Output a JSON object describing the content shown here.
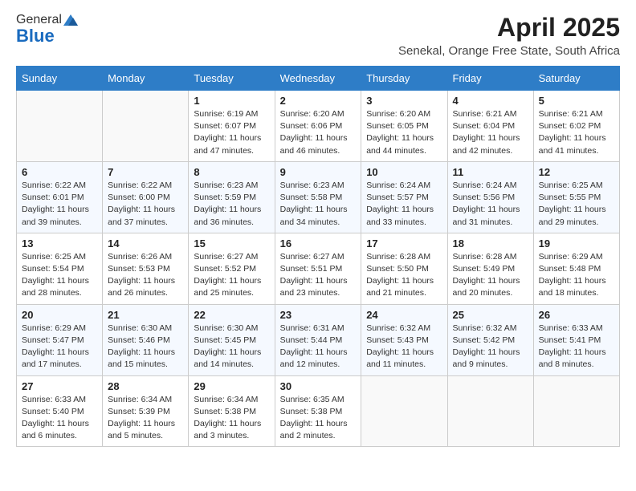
{
  "logo": {
    "general": "General",
    "blue": "Blue"
  },
  "title": "April 2025",
  "location": "Senekal, Orange Free State, South Africa",
  "days_of_week": [
    "Sunday",
    "Monday",
    "Tuesday",
    "Wednesday",
    "Thursday",
    "Friday",
    "Saturday"
  ],
  "weeks": [
    [
      {
        "day": "",
        "info": ""
      },
      {
        "day": "",
        "info": ""
      },
      {
        "day": "1",
        "info": "Sunrise: 6:19 AM\nSunset: 6:07 PM\nDaylight: 11 hours and 47 minutes."
      },
      {
        "day": "2",
        "info": "Sunrise: 6:20 AM\nSunset: 6:06 PM\nDaylight: 11 hours and 46 minutes."
      },
      {
        "day": "3",
        "info": "Sunrise: 6:20 AM\nSunset: 6:05 PM\nDaylight: 11 hours and 44 minutes."
      },
      {
        "day": "4",
        "info": "Sunrise: 6:21 AM\nSunset: 6:04 PM\nDaylight: 11 hours and 42 minutes."
      },
      {
        "day": "5",
        "info": "Sunrise: 6:21 AM\nSunset: 6:02 PM\nDaylight: 11 hours and 41 minutes."
      }
    ],
    [
      {
        "day": "6",
        "info": "Sunrise: 6:22 AM\nSunset: 6:01 PM\nDaylight: 11 hours and 39 minutes."
      },
      {
        "day": "7",
        "info": "Sunrise: 6:22 AM\nSunset: 6:00 PM\nDaylight: 11 hours and 37 minutes."
      },
      {
        "day": "8",
        "info": "Sunrise: 6:23 AM\nSunset: 5:59 PM\nDaylight: 11 hours and 36 minutes."
      },
      {
        "day": "9",
        "info": "Sunrise: 6:23 AM\nSunset: 5:58 PM\nDaylight: 11 hours and 34 minutes."
      },
      {
        "day": "10",
        "info": "Sunrise: 6:24 AM\nSunset: 5:57 PM\nDaylight: 11 hours and 33 minutes."
      },
      {
        "day": "11",
        "info": "Sunrise: 6:24 AM\nSunset: 5:56 PM\nDaylight: 11 hours and 31 minutes."
      },
      {
        "day": "12",
        "info": "Sunrise: 6:25 AM\nSunset: 5:55 PM\nDaylight: 11 hours and 29 minutes."
      }
    ],
    [
      {
        "day": "13",
        "info": "Sunrise: 6:25 AM\nSunset: 5:54 PM\nDaylight: 11 hours and 28 minutes."
      },
      {
        "day": "14",
        "info": "Sunrise: 6:26 AM\nSunset: 5:53 PM\nDaylight: 11 hours and 26 minutes."
      },
      {
        "day": "15",
        "info": "Sunrise: 6:27 AM\nSunset: 5:52 PM\nDaylight: 11 hours and 25 minutes."
      },
      {
        "day": "16",
        "info": "Sunrise: 6:27 AM\nSunset: 5:51 PM\nDaylight: 11 hours and 23 minutes."
      },
      {
        "day": "17",
        "info": "Sunrise: 6:28 AM\nSunset: 5:50 PM\nDaylight: 11 hours and 21 minutes."
      },
      {
        "day": "18",
        "info": "Sunrise: 6:28 AM\nSunset: 5:49 PM\nDaylight: 11 hours and 20 minutes."
      },
      {
        "day": "19",
        "info": "Sunrise: 6:29 AM\nSunset: 5:48 PM\nDaylight: 11 hours and 18 minutes."
      }
    ],
    [
      {
        "day": "20",
        "info": "Sunrise: 6:29 AM\nSunset: 5:47 PM\nDaylight: 11 hours and 17 minutes."
      },
      {
        "day": "21",
        "info": "Sunrise: 6:30 AM\nSunset: 5:46 PM\nDaylight: 11 hours and 15 minutes."
      },
      {
        "day": "22",
        "info": "Sunrise: 6:30 AM\nSunset: 5:45 PM\nDaylight: 11 hours and 14 minutes."
      },
      {
        "day": "23",
        "info": "Sunrise: 6:31 AM\nSunset: 5:44 PM\nDaylight: 11 hours and 12 minutes."
      },
      {
        "day": "24",
        "info": "Sunrise: 6:32 AM\nSunset: 5:43 PM\nDaylight: 11 hours and 11 minutes."
      },
      {
        "day": "25",
        "info": "Sunrise: 6:32 AM\nSunset: 5:42 PM\nDaylight: 11 hours and 9 minutes."
      },
      {
        "day": "26",
        "info": "Sunrise: 6:33 AM\nSunset: 5:41 PM\nDaylight: 11 hours and 8 minutes."
      }
    ],
    [
      {
        "day": "27",
        "info": "Sunrise: 6:33 AM\nSunset: 5:40 PM\nDaylight: 11 hours and 6 minutes."
      },
      {
        "day": "28",
        "info": "Sunrise: 6:34 AM\nSunset: 5:39 PM\nDaylight: 11 hours and 5 minutes."
      },
      {
        "day": "29",
        "info": "Sunrise: 6:34 AM\nSunset: 5:38 PM\nDaylight: 11 hours and 3 minutes."
      },
      {
        "day": "30",
        "info": "Sunrise: 6:35 AM\nSunset: 5:38 PM\nDaylight: 11 hours and 2 minutes."
      },
      {
        "day": "",
        "info": ""
      },
      {
        "day": "",
        "info": ""
      },
      {
        "day": "",
        "info": ""
      }
    ]
  ]
}
